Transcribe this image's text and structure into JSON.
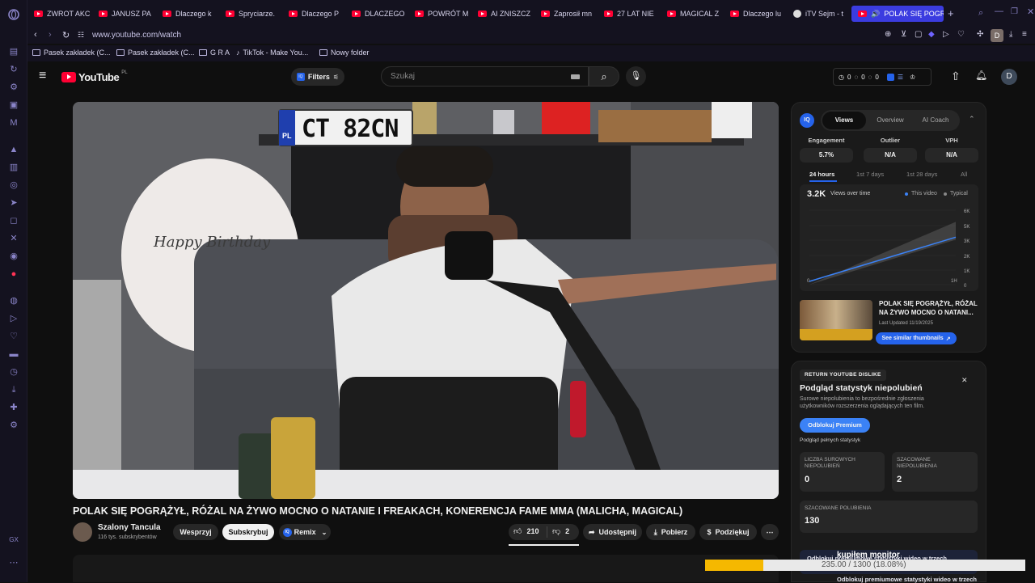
{
  "browser": {
    "tabs": [
      {
        "label": "ZWROT AKC"
      },
      {
        "label": "JANUSZ PA"
      },
      {
        "label": "Dlaczego k"
      },
      {
        "label": "Spryciarze."
      },
      {
        "label": "Dlaczego P"
      },
      {
        "label": "DLACZEGO"
      },
      {
        "label": "POWRÓT M"
      },
      {
        "label": "AI ZNISZCZ"
      },
      {
        "label": "Zaprosił mn"
      },
      {
        "label": "27 LAT NIE"
      },
      {
        "label": "MAGICAL Z"
      },
      {
        "label": "Dlaczego lu"
      },
      {
        "label": "iTV Sejm - t"
      },
      {
        "label": "POLAK SIĘ POGRA"
      }
    ],
    "url": "www.youtube.com/watch",
    "profile_letter": "D",
    "bookmarks": [
      {
        "label": "Pasek zakładek (C..."
      },
      {
        "label": "Pasek zakładek (C..."
      },
      {
        "label": "G R A"
      },
      {
        "label": "TikTok - Make You..."
      },
      {
        "label": "Nowy folder"
      }
    ]
  },
  "youtube": {
    "logo_text": "YouTube",
    "region": "PL",
    "filters_label": "Filters",
    "search_placeholder": "Szukaj",
    "counters": [
      "0",
      "0",
      "0"
    ],
    "avatar_letter": "D"
  },
  "video": {
    "title": "POLAK SIĘ POGRĄŻYŁ, RÓŻAL NA ŻYWO MOCNO O NATANIE I FREAKACH, KONERENCJA FAME MMA (MALICHA, MAGICAL)",
    "plate_text": "CT 82CN",
    "plate_country": "PL",
    "balloon_text": "Happy Birthday",
    "channel_name": "Szalony Tancula",
    "subscribers": "116 tys. subskrybentów",
    "support_label": "Wesprzyj",
    "subscribe_label": "Subskrybuj",
    "remix_label": "Remix",
    "likes": "210",
    "dislikes": "2",
    "share_label": "Udostępnij",
    "download_label": "Pobierz",
    "thanks_label": "Podziękuj"
  },
  "vidiq": {
    "badge": "IQ",
    "tabs": [
      "Views",
      "Overview",
      "AI Coach"
    ],
    "metrics": [
      {
        "label": "Engagement",
        "value": "5.7%"
      },
      {
        "label": "Outlier",
        "value": "N/A"
      },
      {
        "label": "VPH",
        "value": "N/A"
      }
    ],
    "ranges": [
      "24 hours",
      "1st 7 days",
      "1st 28 days",
      "All"
    ],
    "views_value": "3.2K",
    "views_label": "Views over time",
    "legend_this": "This video",
    "legend_typical": "Typical",
    "chart_data": {
      "type": "line",
      "x_labels": [
        "0",
        "1H"
      ],
      "y_ticks": [
        "0",
        "1K",
        "2K",
        "3K",
        "5K",
        "6K"
      ],
      "series": [
        {
          "name": "This video",
          "values": [
            0,
            3200
          ]
        },
        {
          "name": "Typical",
          "values": [
            0,
            3800
          ]
        }
      ]
    },
    "thumb_title": "POLAK SIĘ POGRĄŻYŁ, RÓŻAL NA ŻYWO MOCNO O NATANI...",
    "last_updated": "Last Updated 11/19/2025",
    "similar_label": "See similar thumbnails"
  },
  "dislike": {
    "header": "RETURN YOUTUBE DISLIKE",
    "title": "Podgląd statystyk niepolubień",
    "desc": "Surowe niepolubienia to bezpośrednie zgłoszenia użytkowników rozszerzenia oglądających ten film.",
    "premium_label": "Odblokuj Premium",
    "stats_link": "Podgląd pełnych statystyk",
    "stats": [
      {
        "label": "LICZBA SUROWYCH NIEPOLUBIEŃ",
        "value": "0"
      },
      {
        "label": "SZACOWANE NIEPOLUBIENIA",
        "value": "2"
      },
      {
        "label": "SZACOWANE POLUBIENIA",
        "value": "130"
      }
    ],
    "unlock_text": "Odblokuj premiumowe statystyki wideo w trzech",
    "overlay_text": "kupiłem monitor",
    "progress_text": "235.00 / 1300 (18.08%)",
    "progress_value": 0.1808
  },
  "colors": {
    "accent": "#3b3ce0",
    "yt_red": "#ff0033",
    "vidiq_blue": "#2563eb",
    "progress_gold": "#f5b800"
  }
}
